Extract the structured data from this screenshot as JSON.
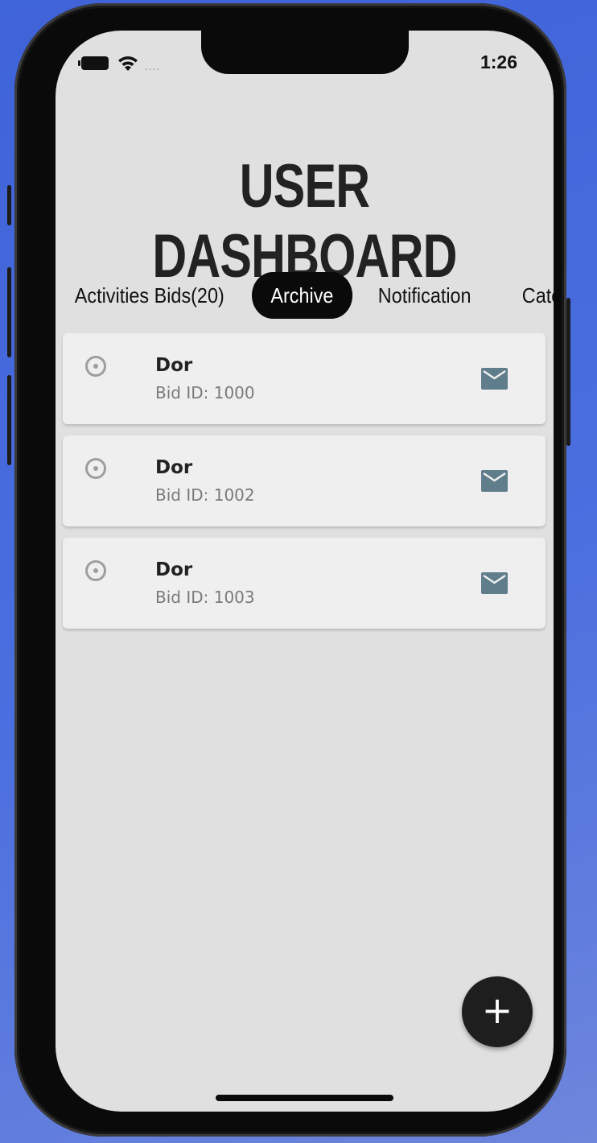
{
  "status_bar": {
    "time": "1:26",
    "signal": "....",
    "icons": [
      "battery-icon",
      "wifi-icon"
    ]
  },
  "header": {
    "title": "User Dashboard"
  },
  "tabs": [
    {
      "label": "Activities Bids(20)",
      "active": false
    },
    {
      "label": "Archive",
      "active": true
    },
    {
      "label": "Notification",
      "active": false
    },
    {
      "label": "Categories",
      "active": false
    }
  ],
  "bids": [
    {
      "name": "Dor",
      "subtitle": "Bid ID: 1000",
      "icon": "envelope-icon"
    },
    {
      "name": "Dor",
      "subtitle": "Bid ID: 1002",
      "icon": "envelope-icon"
    },
    {
      "name": "Dor",
      "subtitle": "Bid ID: 1003",
      "icon": "envelope-icon"
    }
  ],
  "fab": {
    "label": "+"
  },
  "colors": {
    "screen_bg": "#e0e0e0",
    "card_bg": "#efefef",
    "active_tab_bg": "#0a0a0a",
    "mail_icon": "#607d8b",
    "fab_bg": "#1e1e1e"
  }
}
